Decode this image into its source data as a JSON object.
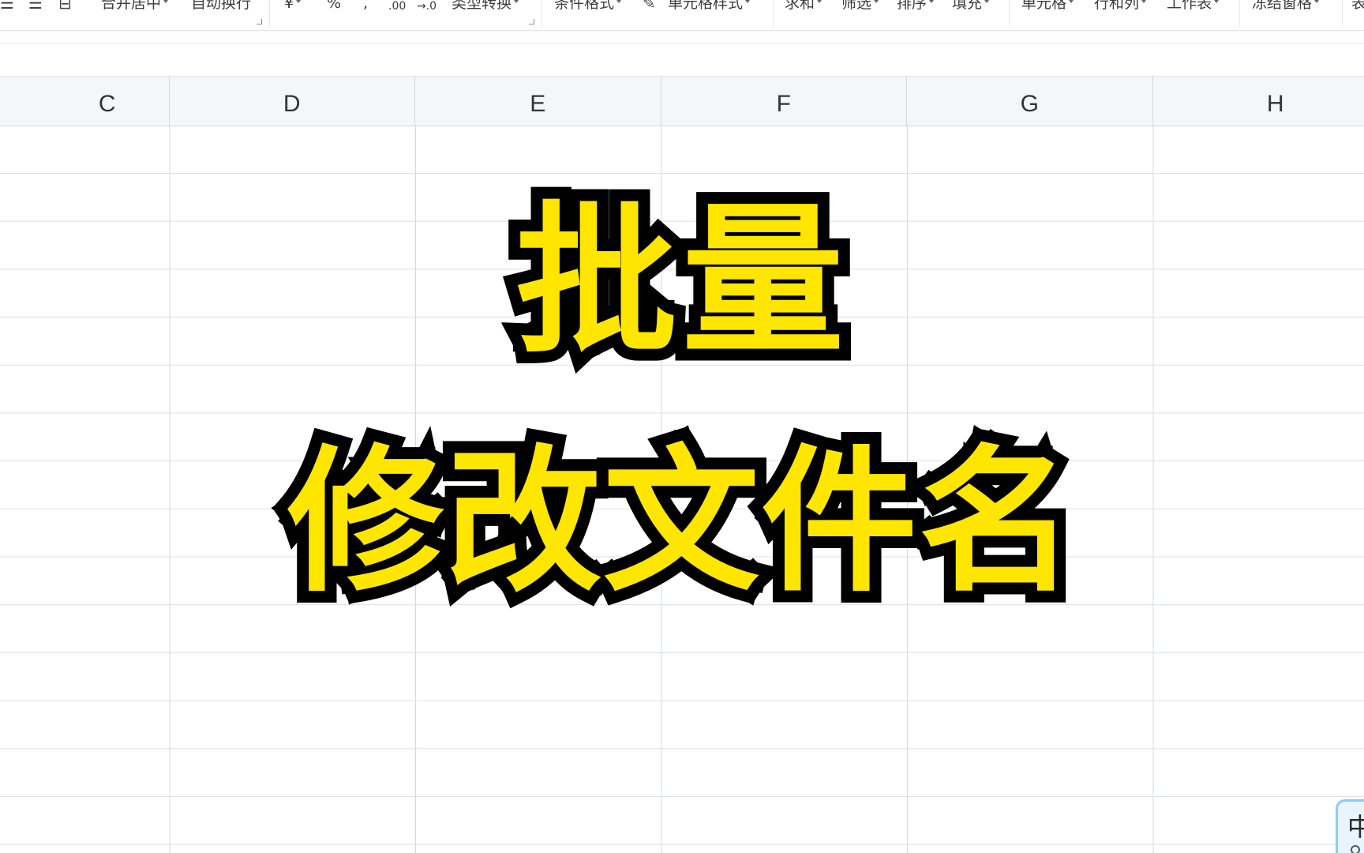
{
  "ribbon": {
    "align_icons": [
      "☰",
      "☰",
      "⊟"
    ],
    "merge_center": "合并居中",
    "wrap_text": "自动换行",
    "currency_symbol": "¥",
    "percent_symbol": "%",
    "comma_symbol": ",",
    "increase_decimal": ".00",
    "decrease_decimal": "→.0",
    "type_convert": "类型转换",
    "conditional_format": "条件格式",
    "cell_style": "单元格样式",
    "sum": "求和",
    "filter": "筛选",
    "sort": "排序",
    "fill": "填充",
    "cell": "单元格",
    "row_col": "行和列",
    "worksheet": "工作表",
    "freeze_panes": "冻结窗格",
    "more": "表"
  },
  "columns": [
    "C",
    "D",
    "E",
    "F",
    "G",
    "H"
  ],
  "overlay": {
    "line1": "批量",
    "line2": "修改文件名",
    "fill_color": "#ffe600",
    "stroke_color": "#000000"
  },
  "ime": {
    "mode": "中"
  }
}
